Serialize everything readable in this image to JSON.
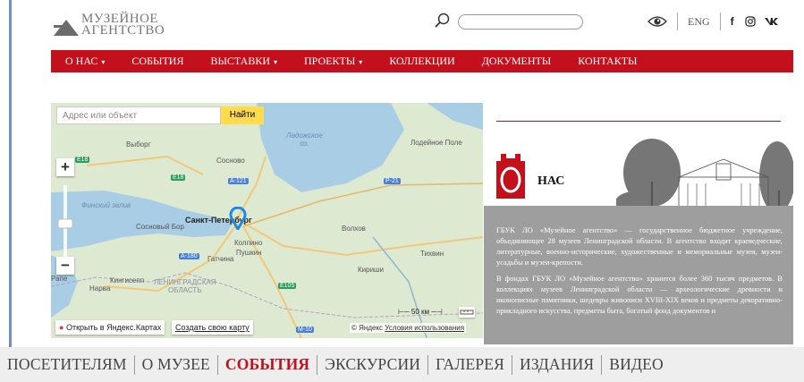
{
  "header": {
    "logo_line1": "МУЗЕЙНОЕ",
    "logo_line2": "АГЕНТСТВО",
    "search_placeholder": "",
    "lang": "ENG",
    "social": [
      "f",
      "◎",
      "vk"
    ]
  },
  "nav": {
    "items": [
      {
        "label": "О НАС",
        "dropdown": true
      },
      {
        "label": "СОБЫТИЯ",
        "dropdown": false
      },
      {
        "label": "ВЫСТАВКИ",
        "dropdown": true
      },
      {
        "label": "ПРОЕКТЫ",
        "dropdown": true
      },
      {
        "label": "КОЛЛЕКЦИИ",
        "dropdown": false
      },
      {
        "label": "ДОКУМЕНТЫ",
        "dropdown": false
      },
      {
        "label": "КОНТАКТЫ",
        "dropdown": false
      }
    ],
    "caret": "▾"
  },
  "map": {
    "address_placeholder": "Адрес или объект",
    "find_button": "Найти",
    "zoom_in": "+",
    "zoom_out": "−",
    "labels": {
      "ladoga": "Ладожское\nоз.",
      "podporozhye": "Лодейное Поле",
      "vyborg": "Выборг",
      "sosnovo": "Сосново",
      "gulf": "Финский залив",
      "spb": "Санкт-Петербург",
      "sosnovy_bor": "Сосновый Бор",
      "volkhov": "Волхов",
      "kolpino": "Колпино",
      "pushkin": "Пушкин",
      "gatchina": "Гатчина",
      "tikhvin": "Тихвин",
      "kingisepp": "Кингисепп",
      "narva": "Нарва",
      "region": "ЛЕНИНГРАДСКАЯ\nОБЛАСТЬ",
      "kirishi": "Кириши",
      "rapla": "Рапе"
    },
    "roads": {
      "e18a": "E18",
      "e18b": "E18",
      "a121": "A-121",
      "p21": "P-21",
      "a180": "A-180",
      "e105": "E105",
      "m10": "M-10"
    },
    "open_in_yandex": "Открыть в Яндекс.Картах",
    "create_map": "Создать свою карту",
    "copyright": "© Яндекс",
    "terms": "Условия использования",
    "scale": "50 км"
  },
  "about": {
    "badge_letter": "О",
    "title_rest": "НАС",
    "paragraph1": "ГБУК ЛО «Музейное агентство» — государственное бюджетное учреждение, объединяющее 28 музеев Ленинградской области. В агентство входят краеведческие, литературные, военно-исторические, художественные и мемориальные музеи, музеи-усадьбы и музеи-крепости.",
    "paragraph2": "В фондах ГБУК ЛО «Музейное агентство» хранится более 360 тысяч предметов. В коллекциях музеев Ленинградской области — археологические древности и иконописные памятники, шедевры живописи XVIII-XIX веков и предметы декоративно-прикладного искусства, предметы быта, богатый фонд документов и"
  },
  "bottom_nav": {
    "items": [
      {
        "label": "ПОСЕТИТЕЛЯМ",
        "active": false
      },
      {
        "label": "О МУЗЕЕ",
        "active": false
      },
      {
        "label": "СОБЫТИЯ",
        "active": true
      },
      {
        "label": "ЭКСКУРСИИ",
        "active": false
      },
      {
        "label": "ГАЛЕРЕЯ",
        "active": false
      },
      {
        "label": "ИЗДАНИЯ",
        "active": false
      },
      {
        "label": "ВИДЕО",
        "active": false
      }
    ]
  },
  "colors": {
    "brand_red": "#c4101c",
    "text_panel": "#9e9e9e",
    "map_button": "#ffdb4d"
  }
}
